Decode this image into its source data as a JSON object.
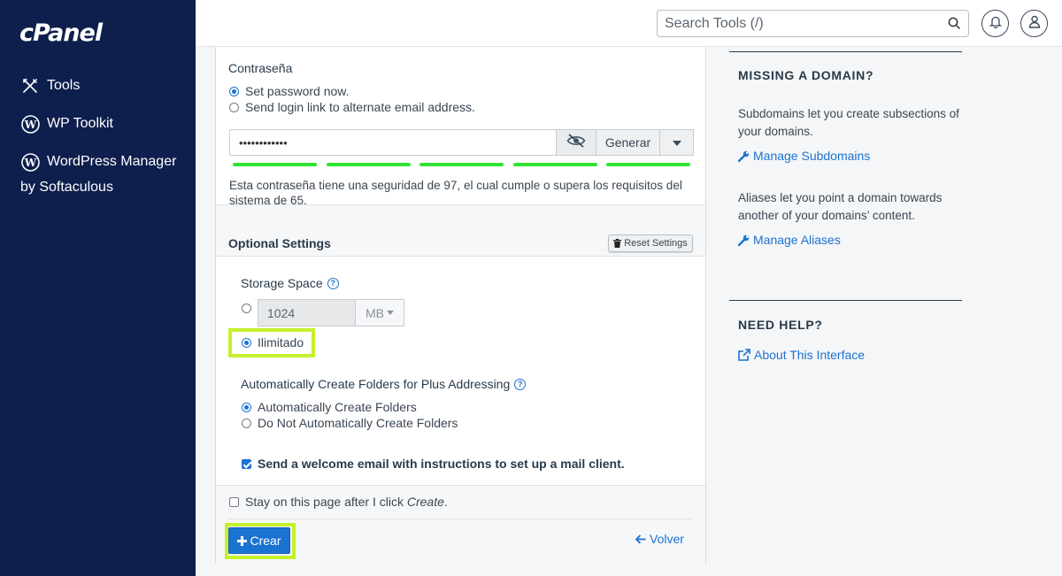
{
  "brand": {
    "logo": "cPanel"
  },
  "sidebar": {
    "items": [
      {
        "label": "Tools",
        "icon": "tools-icon"
      },
      {
        "label": "WP Toolkit",
        "icon": "wordpress-icon"
      },
      {
        "label": "WordPress Manager",
        "icon": "wordpress-icon"
      }
    ],
    "sub_label": "by Softaculous"
  },
  "topbar": {
    "search_placeholder": "Search Tools (/)"
  },
  "password": {
    "section_label": "Contraseña",
    "options": [
      "Set password now.",
      "Send login link to alternate email address."
    ],
    "selected_option": "Set password now.",
    "value": "••••••••••••",
    "generate_label": "Generar",
    "strength_segments_filled": 5,
    "strength_color": "#31e333",
    "message": "Esta contraseña tiene una seguridad de 97, el cual cumple o supera los requisitos del sistema de 65."
  },
  "optional": {
    "title": "Optional Settings",
    "reset_label": "Reset Settings",
    "storage_label": "Storage Space",
    "quota_value": "1024",
    "quota_unit": "MB",
    "unlimited_label": "Ilimitado",
    "selected_storage": "Ilimitado",
    "folders_label": "Automatically Create Folders for Plus Addressing",
    "folder_options": [
      "Automatically Create Folders",
      "Do Not Automatically Create Folders"
    ],
    "selected_folder_option": "Automatically Create Folders",
    "welcome_label": "Send a welcome email with instructions to set up a mail client.",
    "welcome_checked": true
  },
  "footer": {
    "stay_label_prefix": "Stay on this page after I click ",
    "stay_label_em": "Create",
    "stay_label_suffix": ".",
    "stay_checked": false,
    "create_label": "Crear",
    "back_label": "Volver"
  },
  "right": {
    "missing_title": "MISSING A DOMAIN?",
    "subdomains_text": "Subdomains let you create subsections of your domains.",
    "subdomains_link": "Manage Subdomains",
    "aliases_text": "Aliases let you point a domain towards another of your domains’ content.",
    "aliases_link": "Manage Aliases",
    "help_title": "NEED HELP?",
    "help_link": "About This Interface"
  },
  "colors": {
    "sidebar_bg": "#0e1f4d",
    "accent": "#1b73d1",
    "highlight": "#c4f12b"
  }
}
